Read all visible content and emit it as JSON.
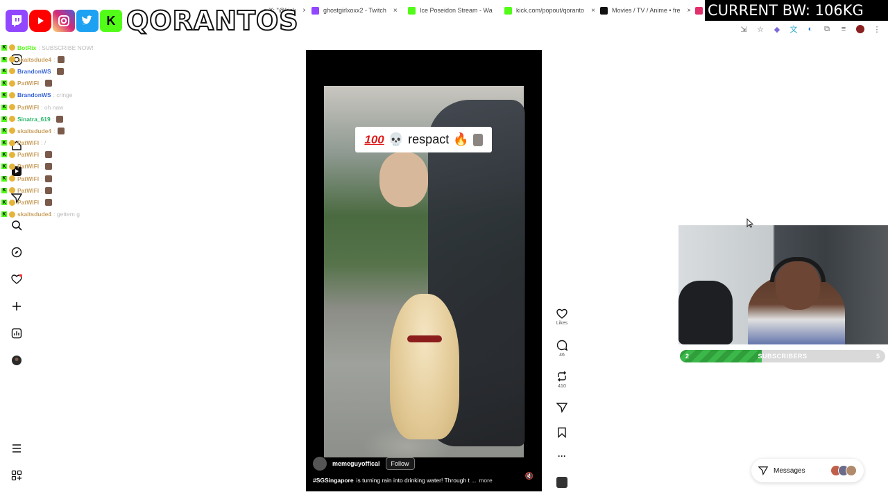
{
  "browser": {
    "tabs": [
      {
        "title": "n X: \"@kick",
        "favicon_color": "#ffffff"
      },
      {
        "title": "ghostgirlxoxx2 - Twitch",
        "favicon_color": "#9146ff"
      },
      {
        "title": "Ice Poseidon Stream - Wa",
        "favicon_color": "#53fc18"
      },
      {
        "title": "kick.com/popout/qoranto",
        "favicon_color": "#53fc18"
      },
      {
        "title": "Movies / TV / Anime • fre",
        "favicon_color": "#111111"
      },
      {
        "title": "",
        "favicon_color": "#e1306c"
      }
    ],
    "tab_close_glyph": "×"
  },
  "overlay": {
    "channel_name": "QORANTOS",
    "socials": [
      {
        "name": "twitch-icon",
        "color": "#9146ff",
        "glyph": "t"
      },
      {
        "name": "youtube-icon",
        "color": "#ff0000",
        "glyph": "▶"
      },
      {
        "name": "instagram-icon",
        "color": "#d62976",
        "glyph": "◎"
      },
      {
        "name": "twitter-icon",
        "color": "#1da1f2",
        "glyph": "🐦"
      },
      {
        "name": "kick-icon",
        "color": "#53fc18",
        "glyph": "K"
      }
    ],
    "bw_banner": "CURRENT BW: 106KG"
  },
  "chat": [
    {
      "user": "BotRix",
      "msg": ": SUBSCRIBE NOW!",
      "user_color": "#53fc18",
      "has_pic": false
    },
    {
      "user": "skaitsdude4",
      "msg": ":",
      "user_color": "#c8a060",
      "has_pic": true
    },
    {
      "user": "BrandonWS",
      "msg": ":",
      "user_color": "#3a66d6",
      "has_pic": true
    },
    {
      "user": "PatWIFI",
      "msg": ":",
      "user_color": "#c8a060",
      "has_pic": true
    },
    {
      "user": "BrandonWS",
      "msg": ": cringe",
      "user_color": "#3a66d6",
      "has_pic": false
    },
    {
      "user": "PatWIFI",
      "msg": ": oh naw",
      "user_color": "#c8a060",
      "has_pic": false
    },
    {
      "user": "Sinatra_619",
      "msg": ":",
      "user_color": "#2bb56a",
      "has_pic": true
    },
    {
      "user": "skaitsdude4",
      "msg": ":",
      "user_color": "#c8a060",
      "has_pic": true
    },
    {
      "user": "PatWIFI",
      "msg": ": /",
      "user_color": "#c8a060",
      "has_pic": false
    },
    {
      "user": "PatWIFI",
      "msg": ":",
      "user_color": "#c8a060",
      "has_pic": true
    },
    {
      "user": "PatWIFI",
      "msg": ":",
      "user_color": "#c8a060",
      "has_pic": true
    },
    {
      "user": "PatWIFI",
      "msg": ":",
      "user_color": "#c8a060",
      "has_pic": true
    },
    {
      "user": "PatWIFI",
      "msg": ":",
      "user_color": "#c8a060",
      "has_pic": true
    },
    {
      "user": "PatWIFI",
      "msg": ":",
      "user_color": "#c8a060",
      "has_pic": true
    },
    {
      "user": "skaitsdude4",
      "msg": ": gettem g",
      "user_color": "#c8a060",
      "has_pic": false
    }
  ],
  "reel": {
    "sticker_hundred": "100",
    "sticker_text": "respact",
    "sticker_emoji_1": "💀",
    "sticker_emoji_2": "🔥",
    "username": "memeguyoffical",
    "follow_label": "Follow",
    "hashtag": "#SGSingapore",
    "description": "is turning rain into drinking water! Through t ...",
    "more_label": "more",
    "mute_glyph": "🔇"
  },
  "actions": {
    "likes_label": "Likes",
    "comments_count": "46",
    "reposts_count": "410",
    "more_glyph": "···"
  },
  "subscribers": {
    "current": "2",
    "label": "SUBSCRIBERS",
    "goal": "5",
    "progress_fraction": 0.4
  },
  "messages": {
    "label": "Messages",
    "face_colors": [
      "#c0604a",
      "#6a6a8a",
      "#b08a6a"
    ]
  }
}
